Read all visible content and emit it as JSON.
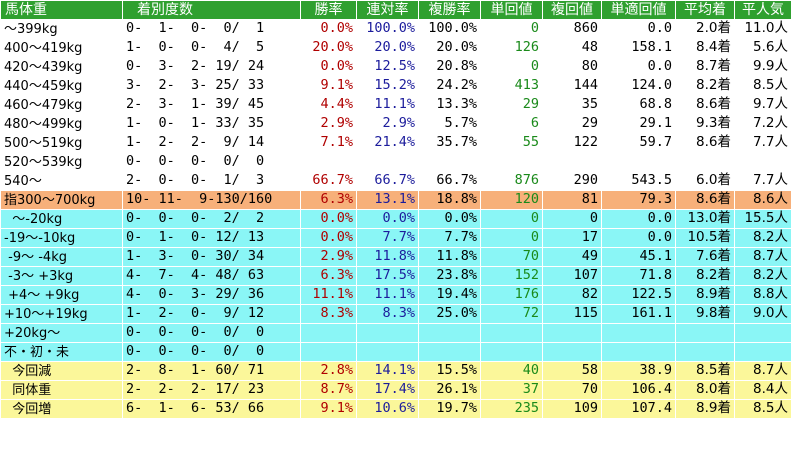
{
  "colors": {
    "header_bg": "#2fa02f",
    "header_text": "#ffffff",
    "group_white": "#ffffff",
    "group_orange": "#f7b07a",
    "group_cyan": "#8af6f6",
    "group_yellow": "#fbf79a",
    "win_red": "#b00000",
    "quinella_blue": "#1c1c9c",
    "tansho_green": "#1a8a1a",
    "default_text": "#000000"
  },
  "headers": [
    "馬体重",
    "着別度数",
    "勝率",
    "連対率",
    "複勝率",
    "単回値",
    "複回値",
    "単適回値",
    "平均着",
    "平人気"
  ],
  "rows": [
    {
      "group": "white",
      "label": "〜399kg",
      "record": "0-  1-  0-  0/  1",
      "win": "0.0%",
      "quinella": "100.0%",
      "place": "100.0%",
      "tansho": "0",
      "fukusho": "860",
      "tantekikai": "0.0",
      "avg_finish": "2.0着",
      "avg_pop": "11.0人"
    },
    {
      "group": "white",
      "label": "400〜419kg",
      "record": "1-  0-  0-  4/  5",
      "win": "20.0%",
      "quinella": "20.0%",
      "place": "20.0%",
      "tansho": "126",
      "fukusho": "48",
      "tantekikai": "158.1",
      "avg_finish": "8.4着",
      "avg_pop": "5.6人"
    },
    {
      "group": "white",
      "label": "420〜439kg",
      "record": "0-  3-  2- 19/ 24",
      "win": "0.0%",
      "quinella": "12.5%",
      "place": "20.8%",
      "tansho": "0",
      "fukusho": "80",
      "tantekikai": "0.0",
      "avg_finish": "8.7着",
      "avg_pop": "9.9人"
    },
    {
      "group": "white",
      "label": "440〜459kg",
      "record": "3-  2-  3- 25/ 33",
      "win": "9.1%",
      "quinella": "15.2%",
      "place": "24.2%",
      "tansho": "413",
      "fukusho": "144",
      "tantekikai": "124.0",
      "avg_finish": "8.2着",
      "avg_pop": "8.5人"
    },
    {
      "group": "white",
      "label": "460〜479kg",
      "record": "2-  3-  1- 39/ 45",
      "win": "4.4%",
      "quinella": "11.1%",
      "place": "13.3%",
      "tansho": "29",
      "fukusho": "35",
      "tantekikai": "68.8",
      "avg_finish": "8.6着",
      "avg_pop": "9.7人"
    },
    {
      "group": "white",
      "label": "480〜499kg",
      "record": "1-  0-  1- 33/ 35",
      "win": "2.9%",
      "quinella": "2.9%",
      "place": "5.7%",
      "tansho": "6",
      "fukusho": "29",
      "tantekikai": "29.1",
      "avg_finish": "9.3着",
      "avg_pop": "7.2人"
    },
    {
      "group": "white",
      "label": "500〜519kg",
      "record": "1-  2-  2-  9/ 14",
      "win": "7.1%",
      "quinella": "21.4%",
      "place": "35.7%",
      "tansho": "55",
      "fukusho": "122",
      "tantekikai": "59.7",
      "avg_finish": "8.6着",
      "avg_pop": "7.7人"
    },
    {
      "group": "white",
      "label": "520〜539kg",
      "record": "0-  0-  0-  0/  0",
      "win": "",
      "quinella": "",
      "place": "",
      "tansho": "",
      "fukusho": "",
      "tantekikai": "",
      "avg_finish": "",
      "avg_pop": ""
    },
    {
      "group": "white",
      "label": "540〜",
      "record": "2-  0-  0-  1/  3",
      "win": "66.7%",
      "quinella": "66.7%",
      "place": "66.7%",
      "tansho": "876",
      "fukusho": "290",
      "tantekikai": "543.5",
      "avg_finish": "6.0着",
      "avg_pop": "7.7人"
    },
    {
      "group": "orange",
      "label": "指300〜700kg",
      "record": "10- 11-  9-130/160",
      "win": "6.3%",
      "quinella": "13.1%",
      "place": "18.8%",
      "tansho": "120",
      "fukusho": "81",
      "tantekikai": "79.3",
      "avg_finish": "8.6着",
      "avg_pop": "8.6人"
    },
    {
      "group": "cyan",
      "label": "  〜-20kg",
      "record": "0-  0-  0-  2/  2",
      "win": "0.0%",
      "quinella": "0.0%",
      "place": "0.0%",
      "tansho": "0",
      "fukusho": "0",
      "tantekikai": "0.0",
      "avg_finish": "13.0着",
      "avg_pop": "15.5人"
    },
    {
      "group": "cyan",
      "label": "-19〜-10kg",
      "record": "0-  1-  0- 12/ 13",
      "win": "0.0%",
      "quinella": "7.7%",
      "place": "7.7%",
      "tansho": "0",
      "fukusho": "17",
      "tantekikai": "0.0",
      "avg_finish": "10.5着",
      "avg_pop": "8.2人"
    },
    {
      "group": "cyan",
      "label": " -9〜 -4kg",
      "record": "1-  3-  0- 30/ 34",
      "win": "2.9%",
      "quinella": "11.8%",
      "place": "11.8%",
      "tansho": "70",
      "fukusho": "49",
      "tantekikai": "45.1",
      "avg_finish": "7.6着",
      "avg_pop": "8.7人"
    },
    {
      "group": "cyan",
      "label": " -3〜 +3kg",
      "record": "4-  7-  4- 48/ 63",
      "win": "6.3%",
      "quinella": "17.5%",
      "place": "23.8%",
      "tansho": "152",
      "fukusho": "107",
      "tantekikai": "71.8",
      "avg_finish": "8.2着",
      "avg_pop": "8.2人"
    },
    {
      "group": "cyan",
      "label": " +4〜 +9kg",
      "record": "4-  0-  3- 29/ 36",
      "win": "11.1%",
      "quinella": "11.1%",
      "place": "19.4%",
      "tansho": "176",
      "fukusho": "82",
      "tantekikai": "122.5",
      "avg_finish": "8.9着",
      "avg_pop": "8.8人"
    },
    {
      "group": "cyan",
      "label": "+10〜+19kg",
      "record": "1-  2-  0-  9/ 12",
      "win": "8.3%",
      "quinella": "8.3%",
      "place": "25.0%",
      "tansho": "72",
      "fukusho": "115",
      "tantekikai": "161.1",
      "avg_finish": "9.8着",
      "avg_pop": "9.0人"
    },
    {
      "group": "cyan",
      "label": "+20kg〜",
      "record": "0-  0-  0-  0/  0",
      "win": "",
      "quinella": "",
      "place": "",
      "tansho": "",
      "fukusho": "",
      "tantekikai": "",
      "avg_finish": "",
      "avg_pop": ""
    },
    {
      "group": "cyan",
      "label": "不・初・未",
      "record": "0-  0-  0-  0/  0",
      "win": "",
      "quinella": "",
      "place": "",
      "tansho": "",
      "fukusho": "",
      "tantekikai": "",
      "avg_finish": "",
      "avg_pop": ""
    },
    {
      "group": "yellow",
      "label": "  今回減",
      "record": "2-  8-  1- 60/ 71",
      "win": "2.8%",
      "quinella": "14.1%",
      "place": "15.5%",
      "tansho": "40",
      "fukusho": "58",
      "tantekikai": "38.9",
      "avg_finish": "8.5着",
      "avg_pop": "8.7人"
    },
    {
      "group": "yellow",
      "label": "  同体重",
      "record": "2-  2-  2- 17/ 23",
      "win": "8.7%",
      "quinella": "17.4%",
      "place": "26.1%",
      "tansho": "37",
      "fukusho": "70",
      "tantekikai": "106.4",
      "avg_finish": "8.0着",
      "avg_pop": "8.4人"
    },
    {
      "group": "yellow",
      "label": "  今回増",
      "record": "6-  1-  6- 53/ 66",
      "win": "9.1%",
      "quinella": "10.6%",
      "place": "19.7%",
      "tansho": "235",
      "fukusho": "109",
      "tantekikai": "107.4",
      "avg_finish": "8.9着",
      "avg_pop": "8.5人"
    }
  ]
}
